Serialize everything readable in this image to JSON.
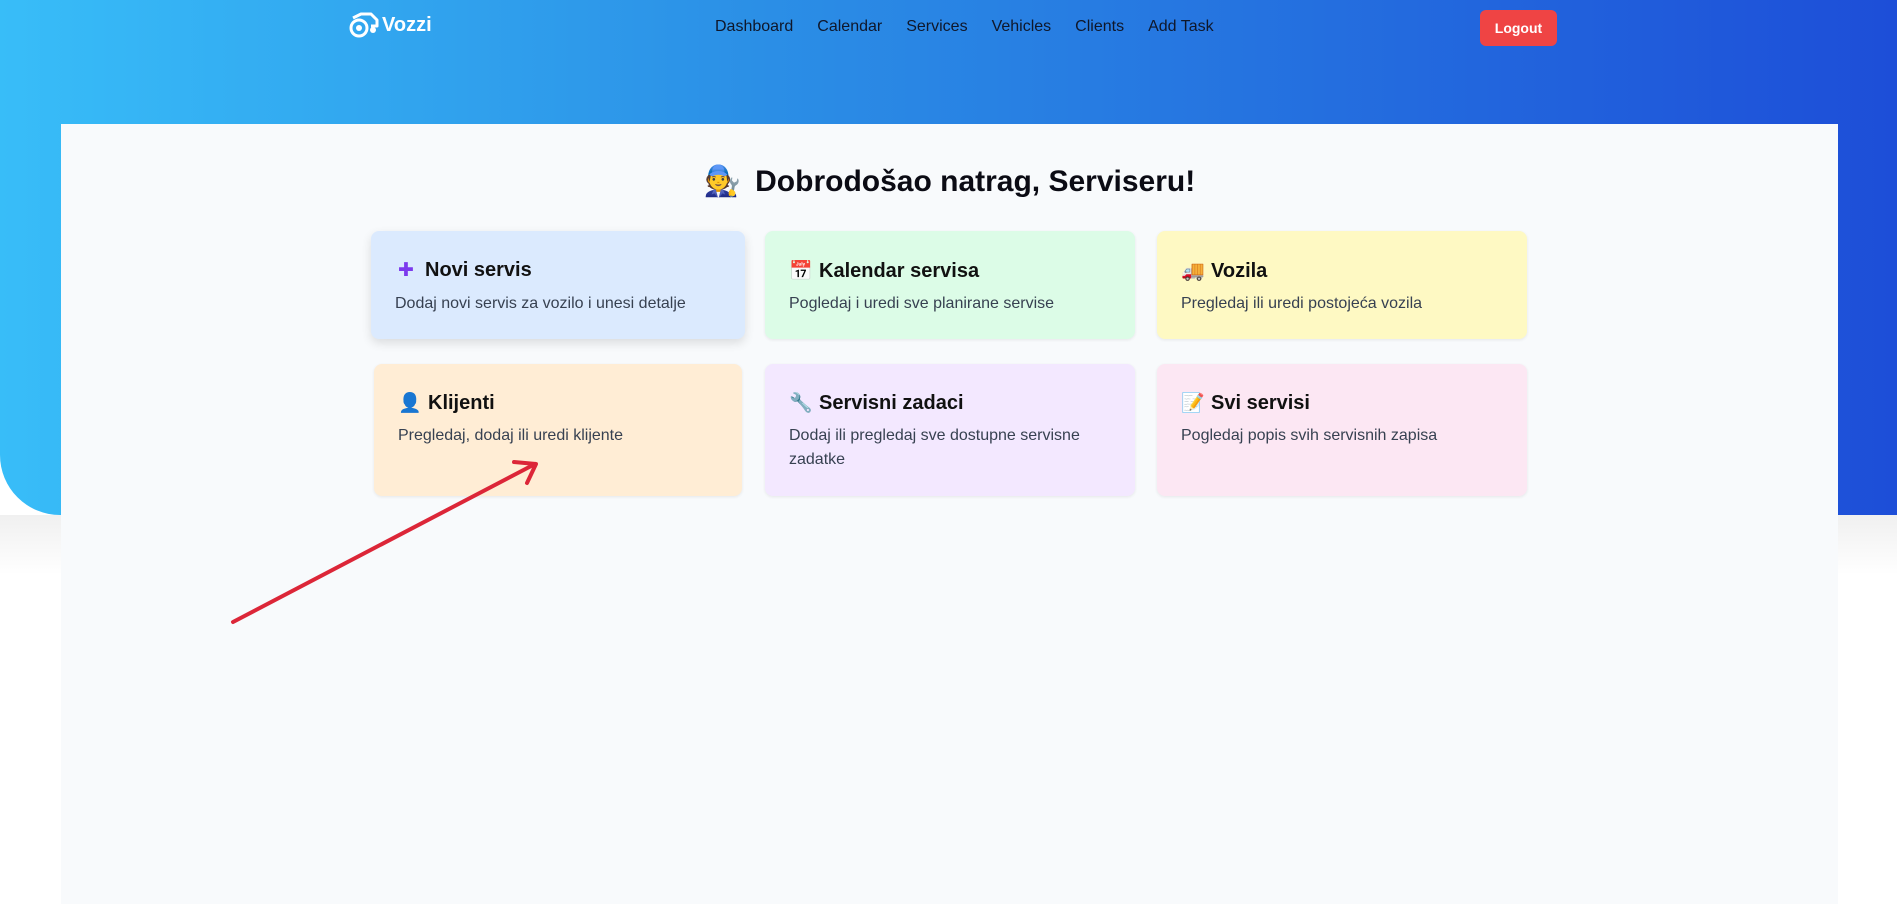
{
  "brand": {
    "name": "Vozzi"
  },
  "nav": {
    "links": [
      "Dashboard",
      "Calendar",
      "Services",
      "Vehicles",
      "Clients",
      "Add Task"
    ],
    "logout_label": "Logout"
  },
  "welcome": {
    "emoji": "🧑‍🔧",
    "text": "Dobrodošao natrag, Serviseru!"
  },
  "cards": [
    {
      "icon": "plus-icon",
      "glyph": "➕",
      "title": "Novi servis",
      "desc": "Dodaj novi servis za vozilo i unesi detalje",
      "color": "#dbeafe"
    },
    {
      "icon": "calendar-icon",
      "glyph": "📅",
      "title": "Kalendar servisa",
      "desc": "Pogledaj i uredi sve planirane servise",
      "color": "#dcfce7"
    },
    {
      "icon": "truck-icon",
      "glyph": "🚚",
      "title": "Vozila",
      "desc": "Pregledaj ili uredi postojeća vozila",
      "color": "#fef9c3"
    },
    {
      "icon": "user-icon",
      "glyph": "👤",
      "title": "Klijenti",
      "desc": "Pregledaj, dodaj ili uredi klijente",
      "color": "#ffedd5"
    },
    {
      "icon": "wrench-icon",
      "glyph": "🔧",
      "title": "Servisni zadaci",
      "desc": "Dodaj ili pregledaj sve dostupne servisne zadatke",
      "color": "#f3e8ff"
    },
    {
      "icon": "memo-icon",
      "glyph": "📝",
      "title": "Svi servisi",
      "desc": "Pogledaj popis svih servisnih zapisa",
      "color": "#fce7f3"
    }
  ],
  "colors": {
    "hero_start": "#38bdf8",
    "hero_end": "#1d4ed8",
    "logout": "#ef4444",
    "annotation_arrow": "#dc2638"
  }
}
